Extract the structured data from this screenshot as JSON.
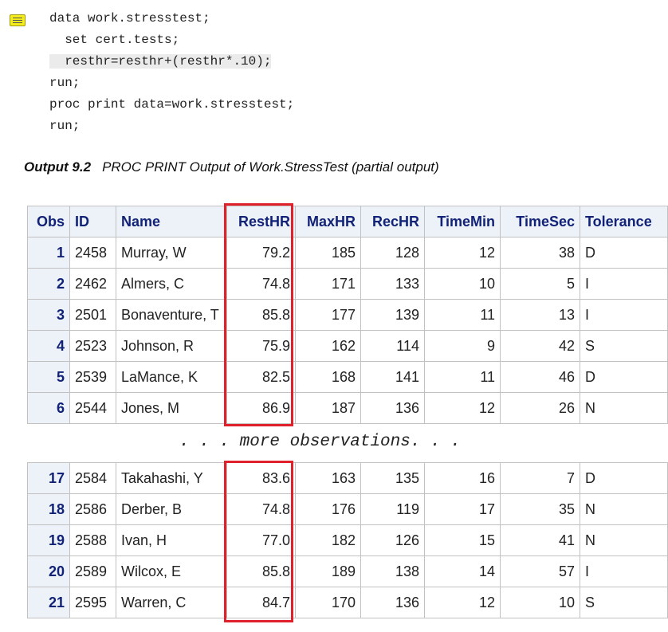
{
  "code_lines": [
    "data work.stresstest;",
    "  set cert.tests;",
    "  resthr=resthr+(resthr*.10);",
    "run;",
    "proc print data=work.stresstest;",
    "run;"
  ],
  "caption": {
    "label": "Output 9.2",
    "title": "PROC PRINT Output of Work.StressTest (partial output)"
  },
  "columns": [
    "Obs",
    "ID",
    "Name",
    "RestHR",
    "MaxHR",
    "RecHR",
    "TimeMin",
    "TimeSec",
    "Tolerance"
  ],
  "rows_top": [
    [
      "1",
      "2458",
      "Murray, W",
      "79.2",
      "185",
      "128",
      "12",
      "38",
      "D"
    ],
    [
      "2",
      "2462",
      "Almers, C",
      "74.8",
      "171",
      "133",
      "10",
      "5",
      "I"
    ],
    [
      "3",
      "2501",
      "Bonaventure, T",
      "85.8",
      "177",
      "139",
      "11",
      "13",
      "I"
    ],
    [
      "4",
      "2523",
      "Johnson, R",
      "75.9",
      "162",
      "114",
      "9",
      "42",
      "S"
    ],
    [
      "5",
      "2539",
      "LaMance, K",
      "82.5",
      "168",
      "141",
      "11",
      "46",
      "D"
    ],
    [
      "6",
      "2544",
      "Jones, M",
      "86.9",
      "187",
      "136",
      "12",
      "26",
      "N"
    ]
  ],
  "more_text": ". . . more observations. . .",
  "rows_bottom": [
    [
      "17",
      "2584",
      "Takahashi, Y",
      "83.6",
      "163",
      "135",
      "16",
      "7",
      "D"
    ],
    [
      "18",
      "2586",
      "Derber, B",
      "74.8",
      "176",
      "119",
      "17",
      "35",
      "N"
    ],
    [
      "19",
      "2588",
      "Ivan, H",
      "77.0",
      "182",
      "126",
      "15",
      "41",
      "N"
    ],
    [
      "20",
      "2589",
      "Wilcox, E",
      "85.8",
      "189",
      "138",
      "14",
      "57",
      "I"
    ],
    [
      "21",
      "2595",
      "Warren, C",
      "84.7",
      "170",
      "136",
      "12",
      "10",
      "S"
    ]
  ],
  "colors": {
    "highlight_box": "#e0202a",
    "header_bg": "#edf2f9",
    "header_text": "#112277"
  }
}
